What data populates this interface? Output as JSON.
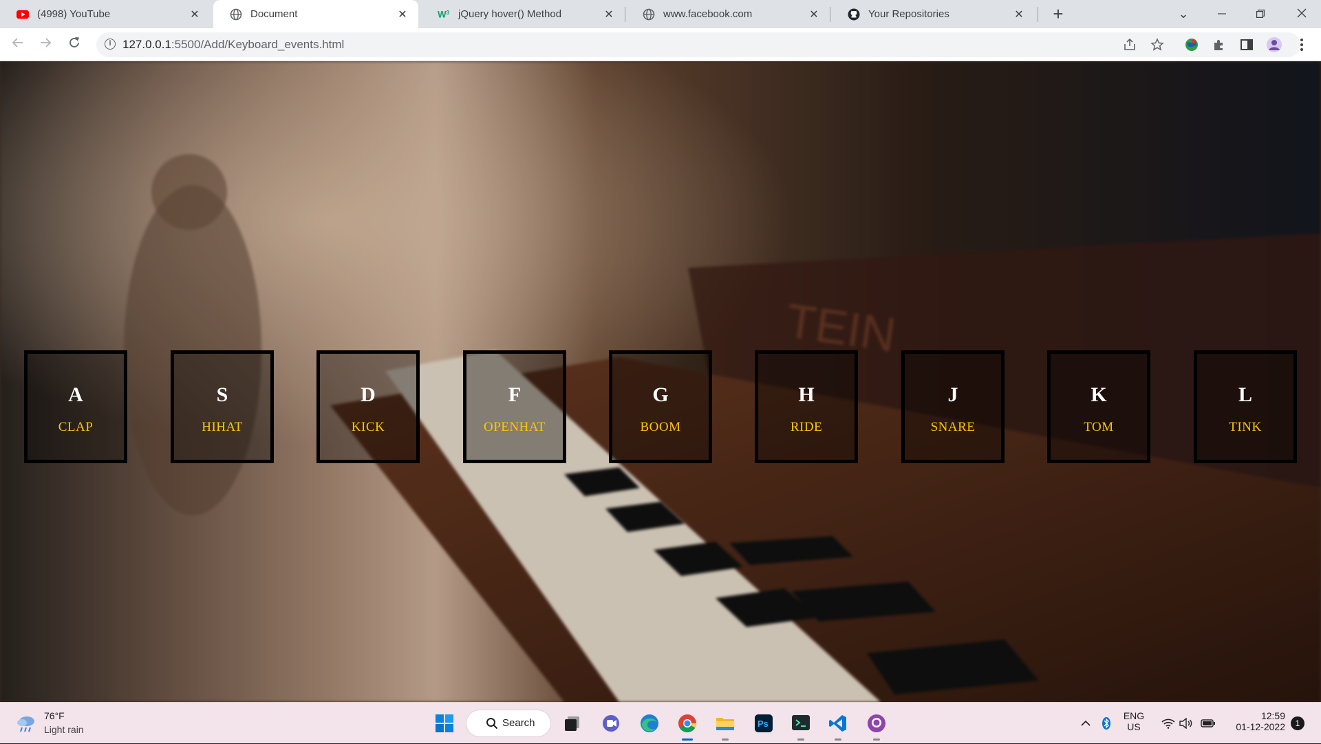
{
  "browser": {
    "tabs": [
      {
        "title": "(4998) YouTube",
        "favicon": "youtube-icon",
        "active": false
      },
      {
        "title": "Document",
        "favicon": "globe-icon",
        "active": true
      },
      {
        "title": "jQuery hover() Method",
        "favicon": "w3schools-icon",
        "active": false
      },
      {
        "title": "www.facebook.com",
        "favicon": "globe-icon",
        "active": false
      },
      {
        "title": "Your Repositories",
        "favicon": "github-icon",
        "active": false
      }
    ],
    "close_glyph": "✕",
    "address": {
      "host": "127.0.0.1",
      "rest": ":5500/Add/Keyboard_events.html"
    }
  },
  "drum_kit": {
    "keys": [
      {
        "letter": "A",
        "sound": "CLAP"
      },
      {
        "letter": "S",
        "sound": "HIHAT"
      },
      {
        "letter": "D",
        "sound": "KICK"
      },
      {
        "letter": "F",
        "sound": "OPENHAT"
      },
      {
        "letter": "G",
        "sound": "BOOM"
      },
      {
        "letter": "H",
        "sound": "RIDE"
      },
      {
        "letter": "J",
        "sound": "SNARE"
      },
      {
        "letter": "K",
        "sound": "TOM"
      },
      {
        "letter": "L",
        "sound": "TINK"
      }
    ],
    "letter_color": "#ffffff",
    "sound_color": "#ffc600",
    "background_text": "TEIN"
  },
  "taskbar": {
    "weather": {
      "temp": "76°F",
      "desc": "Light rain"
    },
    "search_label": "Search",
    "apps": [
      "windows-start-icon",
      "task-view-icon",
      "teams-chat-icon",
      "edge-icon",
      "chrome-icon",
      "file-explorer-icon",
      "photoshop-icon",
      "terminal-icon",
      "vscode-icon",
      "github-desktop-icon"
    ],
    "tray": {
      "lang": "ENG",
      "region": "US",
      "time": "12:59",
      "date": "01-12-2022",
      "notifications": "1"
    }
  }
}
